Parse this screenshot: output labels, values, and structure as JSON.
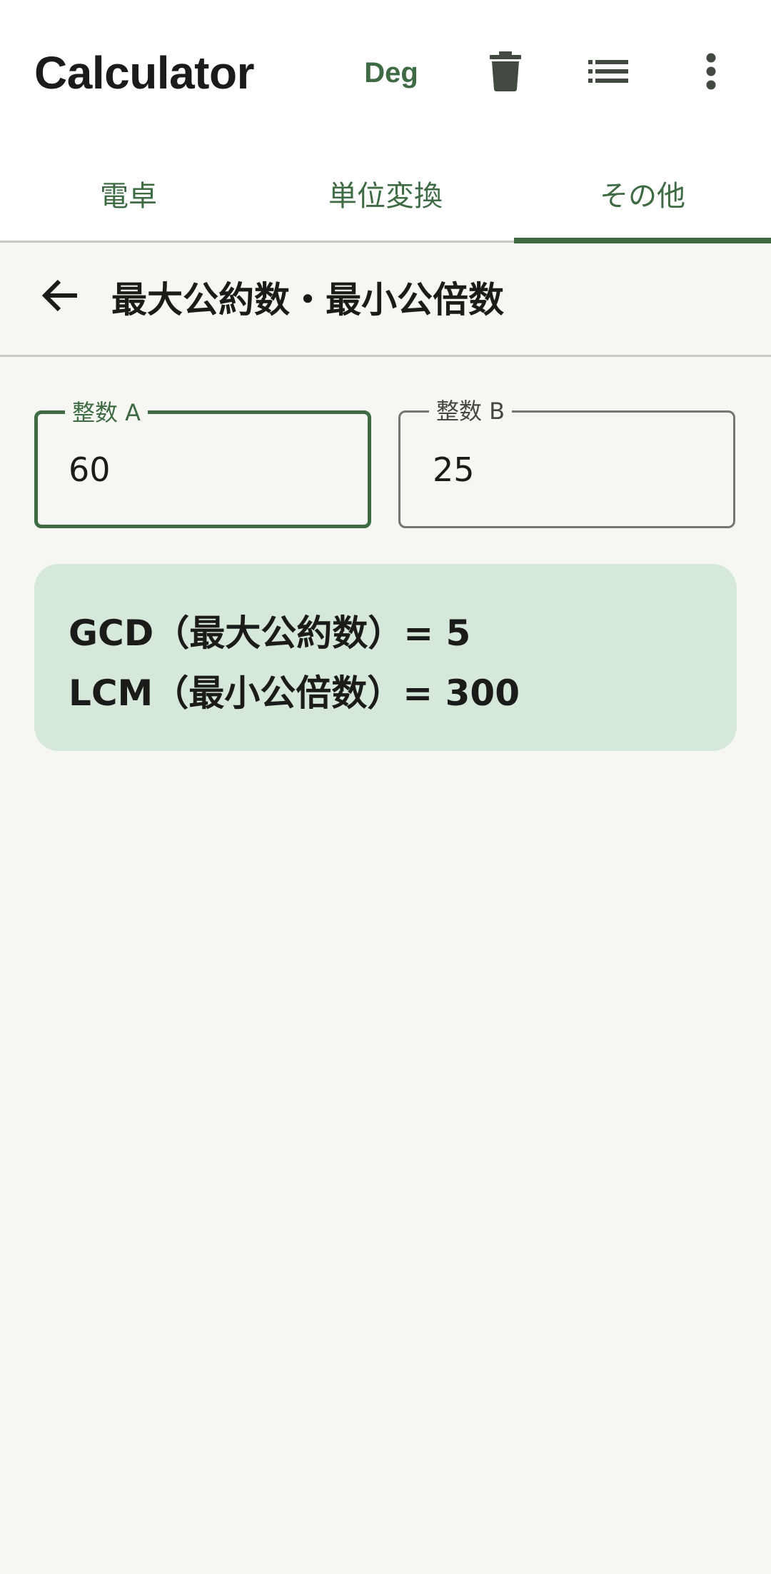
{
  "app_bar": {
    "title": "Calculator",
    "angle_mode_label": "Deg",
    "icons": [
      "delete-icon",
      "history-list-icon",
      "more-vert-icon"
    ]
  },
  "tabs": [
    {
      "label": "電卓",
      "selected": false
    },
    {
      "label": "単位変換",
      "selected": false
    },
    {
      "label": "その他",
      "selected": true
    }
  ],
  "screen": {
    "title": "最大公約数・最小公倍数",
    "back_icon": "arrow-back-icon"
  },
  "inputs": {
    "a": {
      "label": "整数 A",
      "value": "60"
    },
    "b": {
      "label": "整数 B",
      "value": "25"
    }
  },
  "result": {
    "gcd_line": "GCD（最大公約数）= 5",
    "lcm_line": "LCM（最小公倍数）= 300"
  },
  "colors": {
    "accent": "#3e6b43",
    "background": "#f6f7f2",
    "result_card": "#d6e8da"
  }
}
